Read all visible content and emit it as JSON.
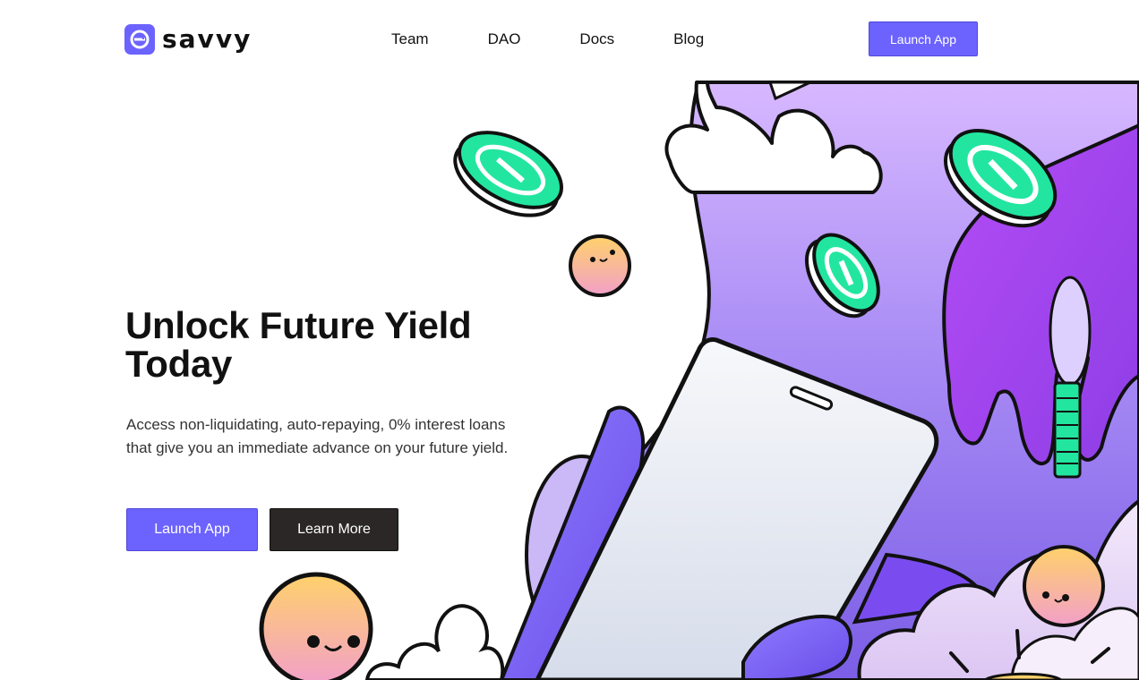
{
  "brand": {
    "name": "savvy",
    "accent": "#6c63ff",
    "dark_button": "#2b2727",
    "coin_green": "#22e6a0"
  },
  "nav": {
    "links": [
      {
        "label": "Team"
      },
      {
        "label": "DAO"
      },
      {
        "label": "Docs"
      },
      {
        "label": "Blog"
      }
    ],
    "launch_label": "Launch App"
  },
  "hero": {
    "title": "Unlock Future Yield Today",
    "subtitle": "Access non-liquidating, auto-repaying, 0% interest loans that give you an immediate advance on your future yield.",
    "primary_label": "Launch App",
    "secondary_label": "Learn More"
  },
  "icons": {
    "logo": "savvy-logo-icon",
    "coin": "savvy-coin-icon",
    "mascot": "smiley-orb-icon",
    "phone": "phone-icon",
    "cloud": "cloud-icon"
  }
}
